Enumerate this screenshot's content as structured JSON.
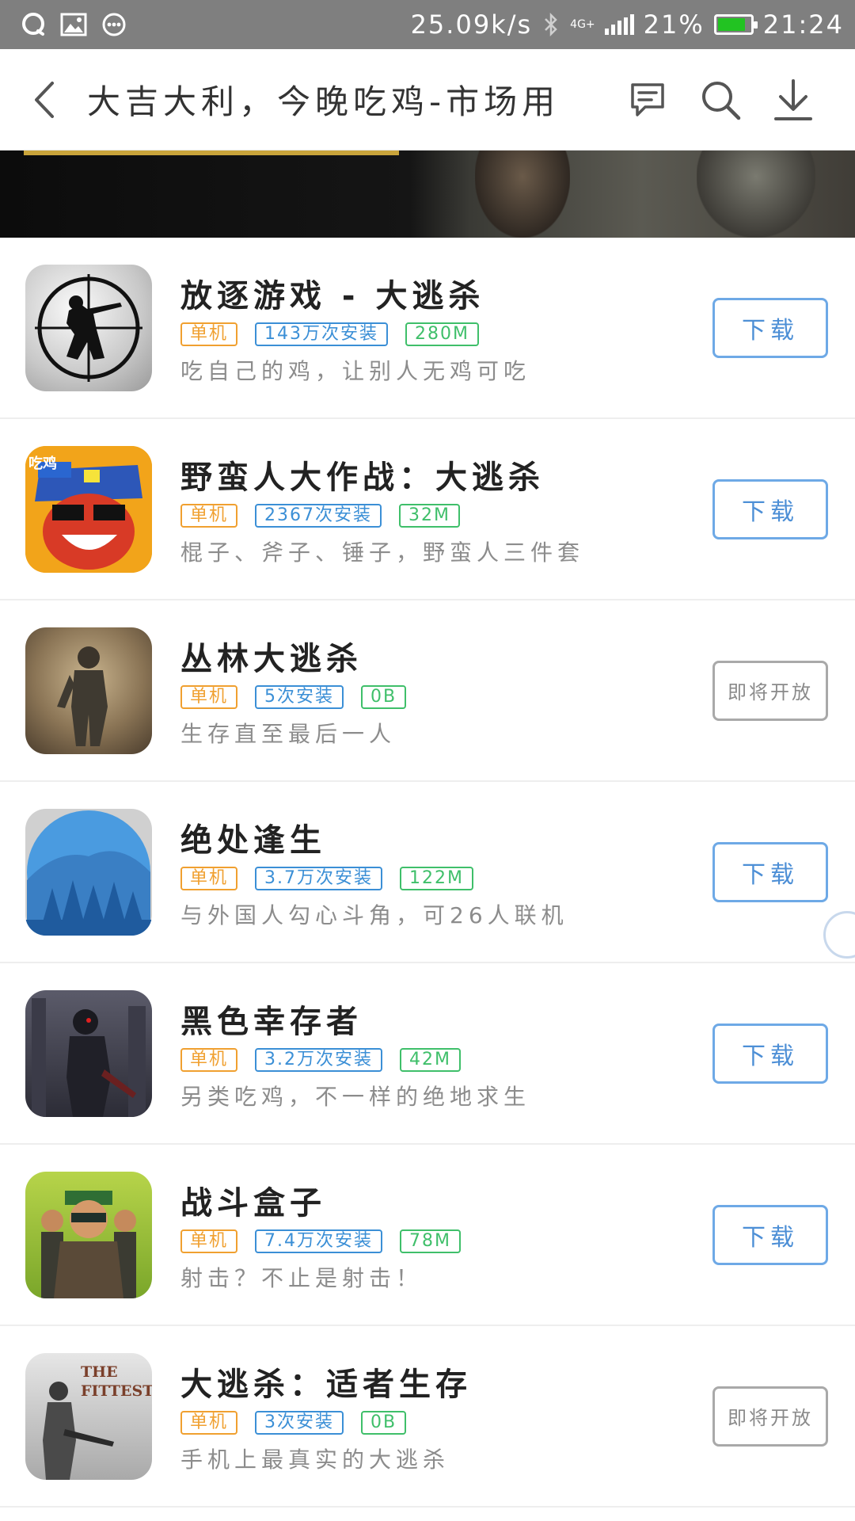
{
  "status": {
    "speed": "25.09k/s",
    "network": "4G+",
    "battery_percent_text": "21%",
    "battery_level": 0.85,
    "time": "21:24",
    "battery_color": "#22c322"
  },
  "header": {
    "back_icon": "chevron-left-icon",
    "title": "大吉大利，今晚吃鸡-市场用",
    "icons": [
      "comment-icon",
      "search-icon",
      "download-icon"
    ]
  },
  "apps": [
    {
      "name": "放逐游戏 - 大逃杀",
      "type": "单机",
      "installs": "143万次安装",
      "size": "280M",
      "desc": "吃自己的鸡，让别人无鸡可吃",
      "button": "下载",
      "button_state": "download"
    },
    {
      "name": "野蛮人大作战：大逃杀",
      "type": "单机",
      "installs": "2367次安装",
      "size": "32M",
      "desc": "棍子、斧子、锤子，野蛮人三件套",
      "button": "下载",
      "button_state": "download",
      "icon_badge": "吃鸡"
    },
    {
      "name": "丛林大逃杀",
      "type": "单机",
      "installs": "5次安装",
      "size": "0B",
      "desc": "生存直至最后一人",
      "button": "即将开放",
      "button_state": "soon"
    },
    {
      "name": "绝处逢生",
      "type": "单机",
      "installs": "3.7万次安装",
      "size": "122M",
      "desc": "与外国人勾心斗角，可26人联机",
      "button": "下载",
      "button_state": "download"
    },
    {
      "name": "黑色幸存者",
      "type": "单机",
      "installs": "3.2万次安装",
      "size": "42M",
      "desc": "另类吃鸡，不一样的绝地求生",
      "button": "下载",
      "button_state": "download"
    },
    {
      "name": "战斗盒子",
      "type": "单机",
      "installs": "7.4万次安装",
      "size": "78M",
      "desc": "射击？不止是射击！",
      "button": "下载",
      "button_state": "download"
    },
    {
      "name": "大逃杀：适者生存",
      "type": "单机",
      "installs": "3次安装",
      "size": "0B",
      "desc": "手机上最真实的大逃杀",
      "button": "即将开放",
      "button_state": "soon",
      "icon_text": "THE FITTEST"
    }
  ],
  "colors": {
    "type_tag": "#f0a030",
    "installs_tag": "#3b8fd6",
    "size_tag": "#3fbf6a",
    "download_button": "#4d8fd6",
    "soon_button": "#8a8a8a"
  }
}
